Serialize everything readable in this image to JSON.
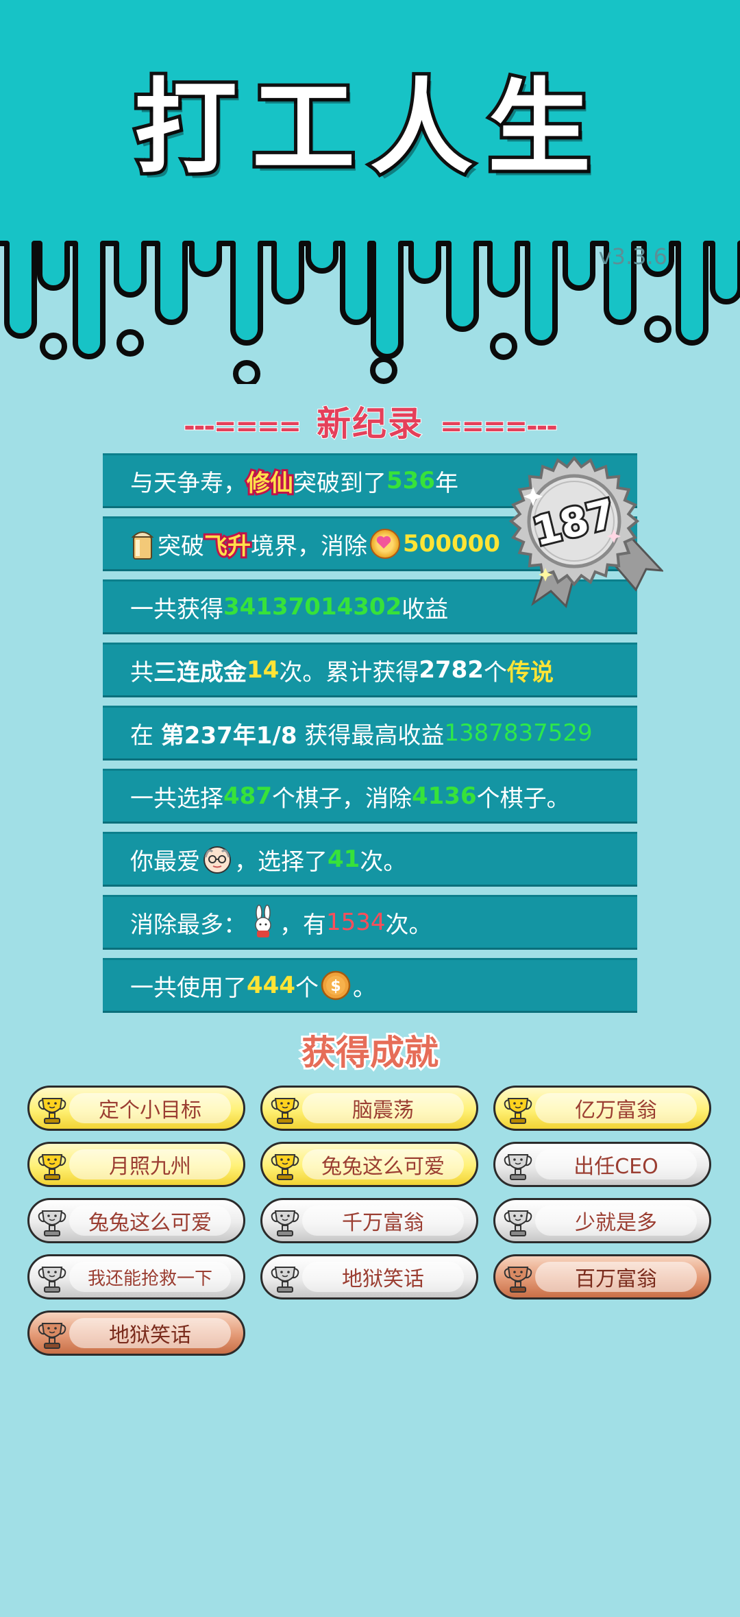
{
  "header": {
    "title": "打工人生",
    "version": "v3.3.6"
  },
  "record": {
    "dash_left": "---====",
    "title": "新纪录",
    "dash_right": "====---",
    "badge_number": "187"
  },
  "rows": {
    "r1": {
      "a": "与天争寿，",
      "tag": "修仙",
      "b": "突破到了",
      "num": "536",
      "c": "年"
    },
    "r2": {
      "a": "突破",
      "tag": "飞升",
      "b": "境界，消除",
      "num": "500000"
    },
    "r3": {
      "a": "一共获得",
      "num": "34137014302",
      "b": "收益"
    },
    "r4": {
      "a": "共",
      "b": "三连成金",
      "num": "14",
      "c": "次。累计获得",
      "num2": "2782",
      "d": "个",
      "e": "传说"
    },
    "r5": {
      "a": "在 ",
      "b": "第237年1/8",
      "c": " 获得最高收益",
      "num": "1387837529"
    },
    "r6": {
      "a": "一共选择",
      "num": "487",
      "b": "个棋子，消除",
      "num2": "4136",
      "c": "个棋子。"
    },
    "r7": {
      "a": "你最爱",
      "b": "，选择了",
      "num": "41",
      "c": "次。"
    },
    "r8": {
      "a": "消除最多：",
      "b": "，有",
      "num": "1534",
      "c": "次。"
    },
    "r9": {
      "a": "一共使用了",
      "num": "444",
      "b": "个",
      "c": "。"
    }
  },
  "achievements": {
    "title": "获得成就",
    "items": [
      {
        "label": "定个小目标",
        "tier": "gold"
      },
      {
        "label": "脑震荡",
        "tier": "gold"
      },
      {
        "label": "亿万富翁",
        "tier": "gold"
      },
      {
        "label": "月照九州",
        "tier": "gold"
      },
      {
        "label": "兔兔这么可爱",
        "tier": "gold"
      },
      {
        "label": "出任CEO",
        "tier": "silver"
      },
      {
        "label": "兔兔这么可爱",
        "tier": "silver"
      },
      {
        "label": "千万富翁",
        "tier": "silver"
      },
      {
        "label": "少就是多",
        "tier": "silver"
      },
      {
        "label": "我还能抢救一下",
        "tier": "silver"
      },
      {
        "label": "地狱笑话",
        "tier": "silver"
      },
      {
        "label": "百万富翁",
        "tier": "bronze"
      },
      {
        "label": "地狱笑话",
        "tier": "bronze"
      }
    ]
  },
  "colors": {
    "header_bg": "#17c3c6",
    "page_bg": "#a1dfe6",
    "row_bg": "#1495a3",
    "green": "#37e23a",
    "yellow": "#ffe435",
    "red": "#ff4d59",
    "heading_red": "#e4405a"
  },
  "icons": {
    "r2": "bucket-icon",
    "r2b": "heart-coin-icon",
    "r7": "old-man-face-icon",
    "r8": "rabbit-icon",
    "r9": "dollar-coin-icon",
    "badge": "silver-rosette-badge"
  }
}
